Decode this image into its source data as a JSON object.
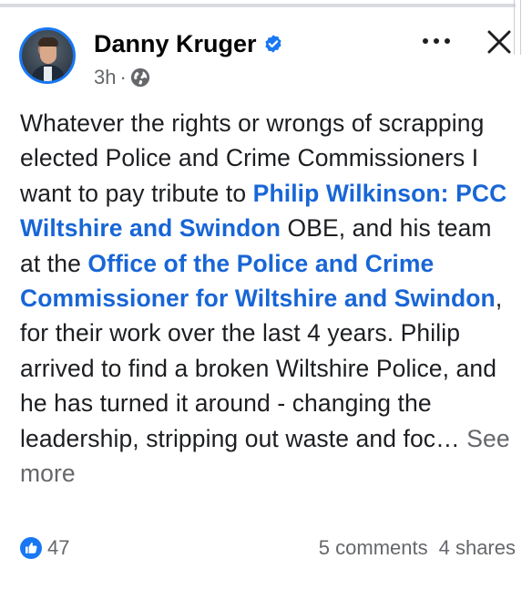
{
  "post": {
    "author": "Danny Kruger",
    "time": "3h",
    "separator": "·",
    "text_1": "Whatever the rights or wrongs of scrapping elected Police and Crime Commissioners I want to pay tribute to ",
    "mention_1": "Philip Wilkinson: PCC Wiltshire and Swindon",
    "text_2": " OBE, and his team at the ",
    "mention_2": "Office of the Police and Crime Commissioner for Wiltshire and Swindon",
    "text_3": ", for their work over the last 4 years. Philip arrived to find a broken Wiltshire Police, and he has turned it around - changing the leadership, stripping out waste and foc… ",
    "see_more": "See more"
  },
  "reactions": {
    "likes": "47",
    "comments": "5 comments",
    "shares": "4 shares"
  },
  "icons": {
    "verified": "verified-badge-icon",
    "globe": "public-globe-icon",
    "more": "more-options-icon",
    "close": "close-icon",
    "like": "like-reaction-icon"
  },
  "colors": {
    "accent": "#1877f2",
    "mention": "#1866d6",
    "secondary_text": "#65676b"
  }
}
